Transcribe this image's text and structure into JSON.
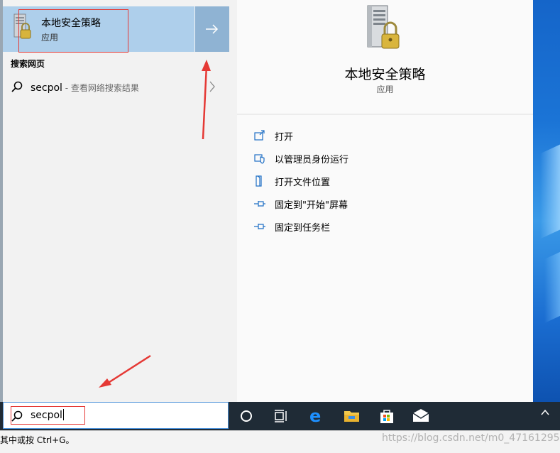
{
  "best_match": {
    "title": "本地安全策略",
    "subtitle": "应用"
  },
  "web_section": {
    "heading": "搜索网页",
    "query": "secpol",
    "hint": " - 查看网络搜索结果"
  },
  "details": {
    "title": "本地安全策略",
    "subtitle": "应用",
    "actions": [
      {
        "label": "打开",
        "icon": "open-icon"
      },
      {
        "label": "以管理员身份运行",
        "icon": "shield-icon"
      },
      {
        "label": "打开文件位置",
        "icon": "file-location-icon"
      },
      {
        "label": "固定到\"开始\"屏幕",
        "icon": "pin-icon"
      },
      {
        "label": "固定到任务栏",
        "icon": "pin-icon"
      }
    ]
  },
  "taskbar": {
    "search_value": "secpol",
    "icons": [
      "cortana-icon",
      "task-view-icon",
      "edge-icon",
      "file-explorer-icon",
      "store-icon",
      "mail-icon"
    ],
    "tray_chevron": "^"
  },
  "status": {
    "text": "其中或按 Ctrl+G。"
  },
  "watermark": "https://blog.csdn.net/m0_47161295",
  "colors": {
    "selected_bg": "#aecfeb",
    "arrow_bg": "#8fb3d3",
    "accent": "#0078d7",
    "taskbar": "#1f2b36",
    "annotation": "#e53935"
  }
}
